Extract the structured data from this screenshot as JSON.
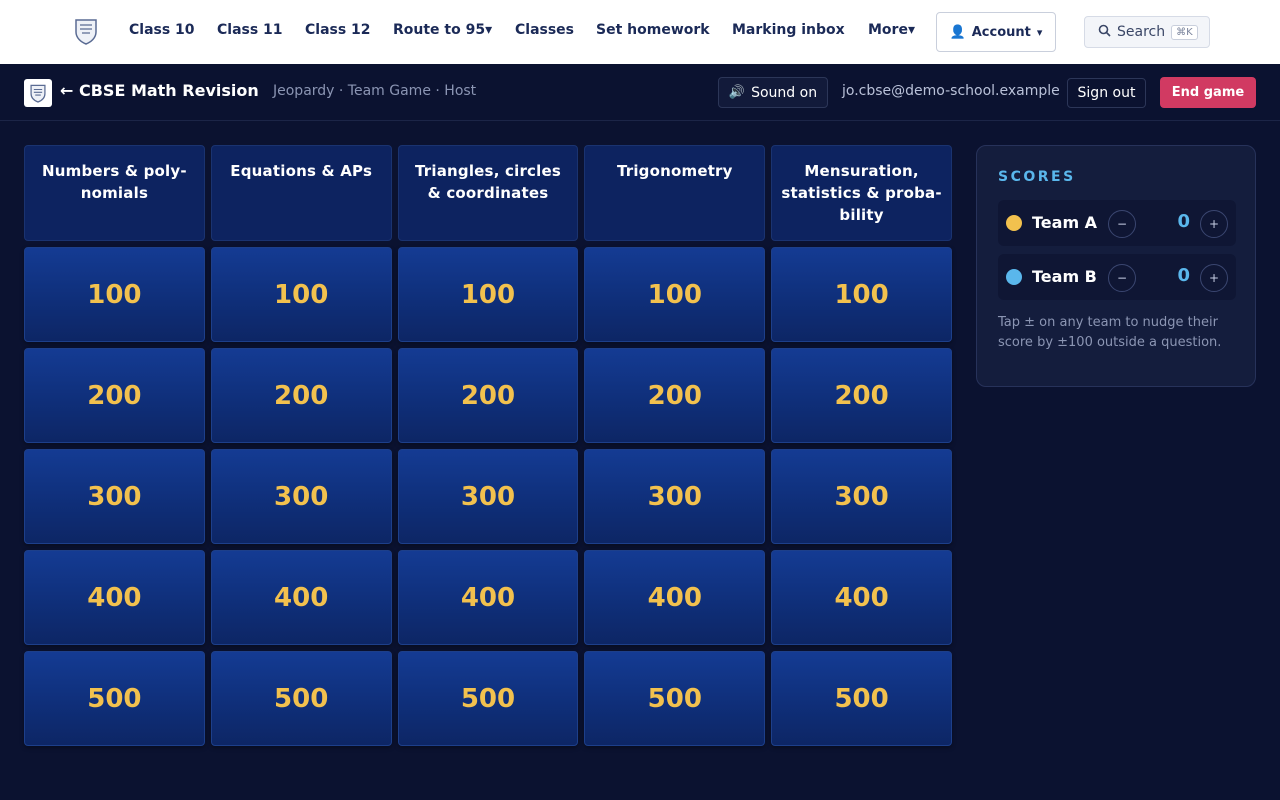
{
  "nav": {
    "links": [
      "Class 10",
      "Class 11",
      "Class 12",
      "Route to 95▾",
      "Classes",
      "Set homework",
      "Marking inbox",
      "More▾"
    ],
    "account_label": "Account",
    "account_icon": "person-icon",
    "account_caret": "▾",
    "search_label": "Search",
    "search_shortcut": "⌘K"
  },
  "game": {
    "title": "← CBSE Math Revision",
    "subtitle": "Jeopardy · Team Game · Host",
    "sound_label": "Sound on",
    "sound_icon": "🔊",
    "email": "jo.cbse@demo-school.example",
    "signout_label": "Sign out",
    "endgame_label": "End game"
  },
  "board": {
    "categories": [
      "Numbers & poly-nomials",
      "Equations & APs",
      "Triangles, circles & coordinates",
      "Trigonometry",
      "Mensuration, statistics & proba-bility"
    ],
    "values": [
      "100",
      "200",
      "300",
      "400",
      "500"
    ]
  },
  "scores": {
    "title": "SCORES",
    "teams": [
      {
        "name": "Team A",
        "score": "0",
        "color": "#f2c14e"
      },
      {
        "name": "Team B",
        "score": "0",
        "color": "#5ab7ec"
      }
    ],
    "minus_label": "−",
    "plus_label": "+",
    "note": "Tap ± on any team to nudge their score by ±100 outside a question."
  },
  "colors": {
    "background": "#0b1230",
    "tile_value": "#f2c14e",
    "accent": "#5ab7ec",
    "danger": "#d13a62"
  }
}
